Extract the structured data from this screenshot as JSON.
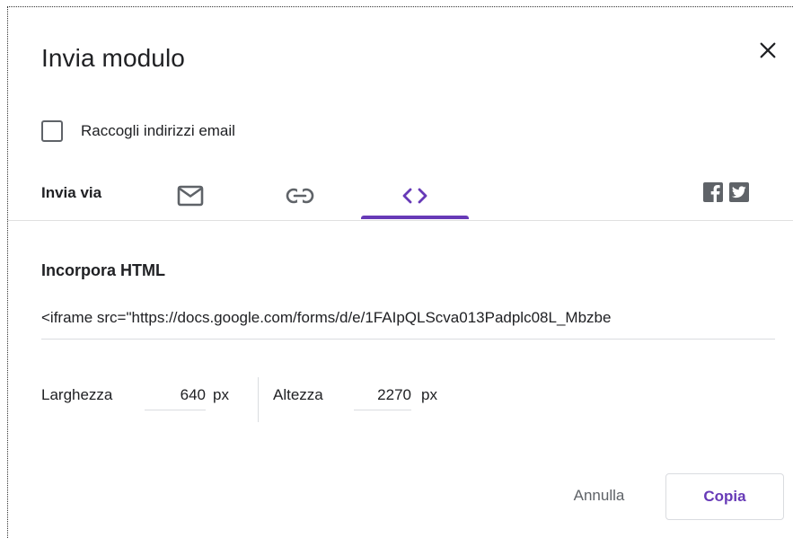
{
  "dialog": {
    "title": "Invia modulo",
    "close_icon": "close-icon"
  },
  "collect_emails": {
    "label": "Raccogli indirizzi email",
    "checked": false
  },
  "send_via": {
    "label": "Invia via",
    "tabs": [
      {
        "id": "email",
        "icon": "mail-icon",
        "selected": false
      },
      {
        "id": "link",
        "icon": "link-icon",
        "selected": false
      },
      {
        "id": "embed",
        "icon": "code-icon",
        "selected": true
      }
    ],
    "social": [
      {
        "id": "facebook",
        "icon": "facebook-icon"
      },
      {
        "id": "twitter",
        "icon": "twitter-icon"
      }
    ]
  },
  "embed": {
    "heading": "Incorpora HTML",
    "code": "<iframe src=\"https://docs.google.com/forms/d/e/1FAIpQLScva013Padplc08L_Mbzbe",
    "width_label": "Larghezza",
    "width_value": "640",
    "width_unit": "px",
    "height_label": "Altezza",
    "height_value": "2270",
    "height_unit": "px"
  },
  "actions": {
    "cancel_label": "Annulla",
    "copy_label": "Copia"
  },
  "colors": {
    "accent": "#673ab7",
    "text": "#202124",
    "icon": "#5f6368",
    "divider": "#e0e0e0"
  }
}
